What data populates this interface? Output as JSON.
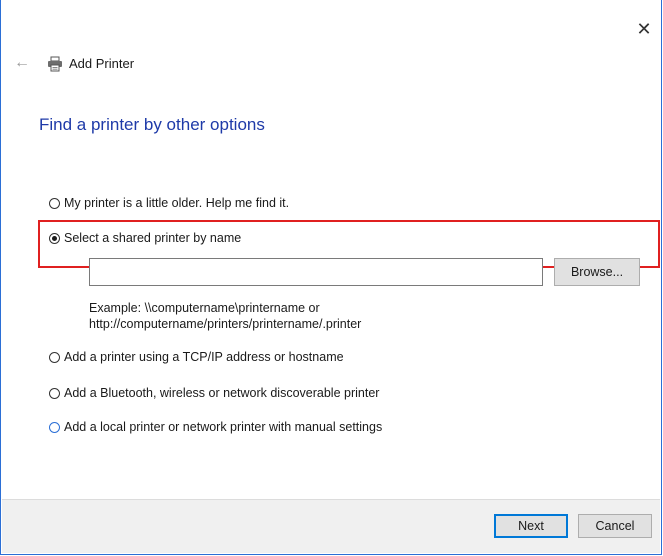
{
  "window": {
    "close_glyph": "✕",
    "back_glyph": "←",
    "title": "Add Printer",
    "heading": "Find a printer by other options"
  },
  "options": [
    {
      "label": "My printer is a little older. Help me find it.",
      "selected": false
    },
    {
      "label": "Select a shared printer by name",
      "selected": true
    },
    {
      "label": "Add a printer using a TCP/IP address or hostname",
      "selected": false
    },
    {
      "label": "Add a Bluetooth, wireless or network discoverable printer",
      "selected": false
    },
    {
      "label": "Add a local printer or network printer with manual settings",
      "selected": false
    }
  ],
  "shared_printer": {
    "input_value": "",
    "browse_label": "Browse...",
    "example_line1": "Example: \\\\computername\\printername or",
    "example_line2": "http://computername/printers/printername/.printer"
  },
  "footer": {
    "next_label": "Next",
    "cancel_label": "Cancel"
  },
  "colors": {
    "heading": "#1e3aa8",
    "highlight": "#e02020",
    "accent": "#2b6fd6"
  }
}
